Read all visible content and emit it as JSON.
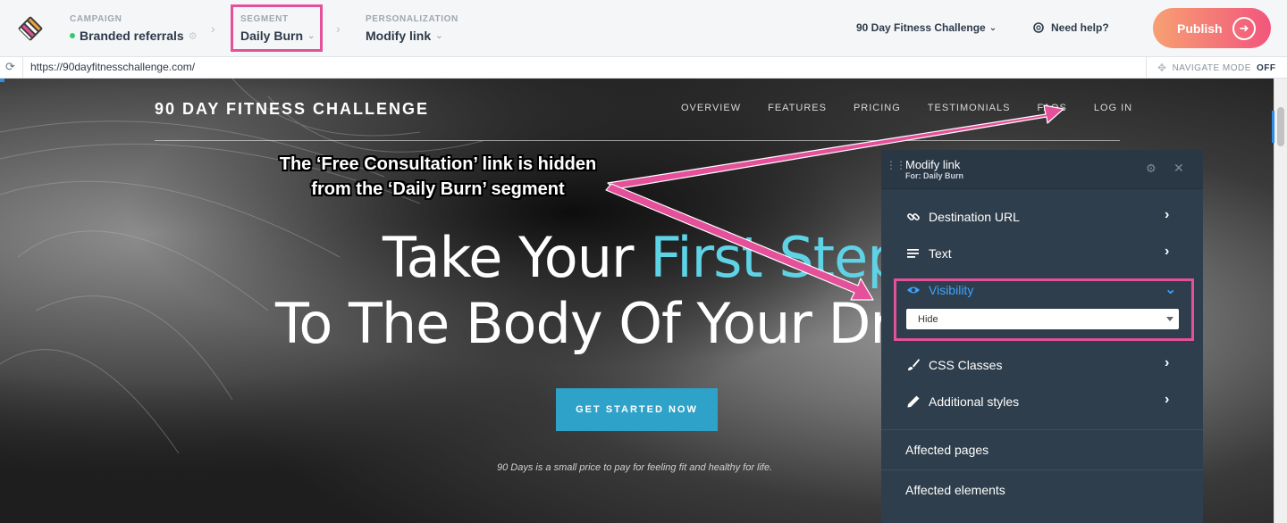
{
  "topbar": {
    "campaign": {
      "label": "CAMPAIGN",
      "value": "Branded referrals"
    },
    "segment": {
      "label": "SEGMENT",
      "value": "Daily Burn"
    },
    "personalization": {
      "label": "PERSONALIZATION",
      "value": "Modify link"
    },
    "campaign_title": "90 Day Fitness Challenge",
    "help_label": "Need help?",
    "publish_label": "Publish"
  },
  "urlbar": {
    "url": "https://90dayfitnesschallenge.com/",
    "nav_mode_label": "NAVIGATE MODE",
    "nav_mode_state": "OFF"
  },
  "site": {
    "brand": "90 DAY FITNESS CHALLENGE",
    "nav": [
      "OVERVIEW",
      "FEATURES",
      "PRICING",
      "TESTIMONIALS",
      "FAQS",
      "LOG IN"
    ],
    "hero_line1_a": "Take Your ",
    "hero_line1_b": "First Step",
    "hero_line2": "To The Body Of Your Dre",
    "cta": "GET STARTED NOW",
    "tagline": "90 Days is a small price to pay for feeling fit and healthy for life."
  },
  "callout": {
    "line1": "The ‘Free Consultation’ link is hidden",
    "line2": "from the ‘Daily Burn’ segment"
  },
  "panel": {
    "title": "Modify link",
    "subtitle": "For: Daily Burn",
    "rows": [
      {
        "label": "Destination URL",
        "icon": "link-icon"
      },
      {
        "label": "Text",
        "icon": "text-lines-icon"
      },
      {
        "label": "Visibility",
        "icon": "eye-icon",
        "active": true
      },
      {
        "label": "CSS Classes",
        "icon": "brush-icon"
      },
      {
        "label": "Additional styles",
        "icon": "pencil-icon"
      }
    ],
    "visibility_value": "Hide",
    "sections": [
      "Affected pages",
      "Affected elements"
    ]
  },
  "colors": {
    "accent_pink": "#e4509a",
    "accent_blue": "#3ea3ff",
    "hero_accent": "#5fd3e6",
    "cta_bg": "#2fa2c9",
    "panel_bg": "#2f3e4c"
  }
}
